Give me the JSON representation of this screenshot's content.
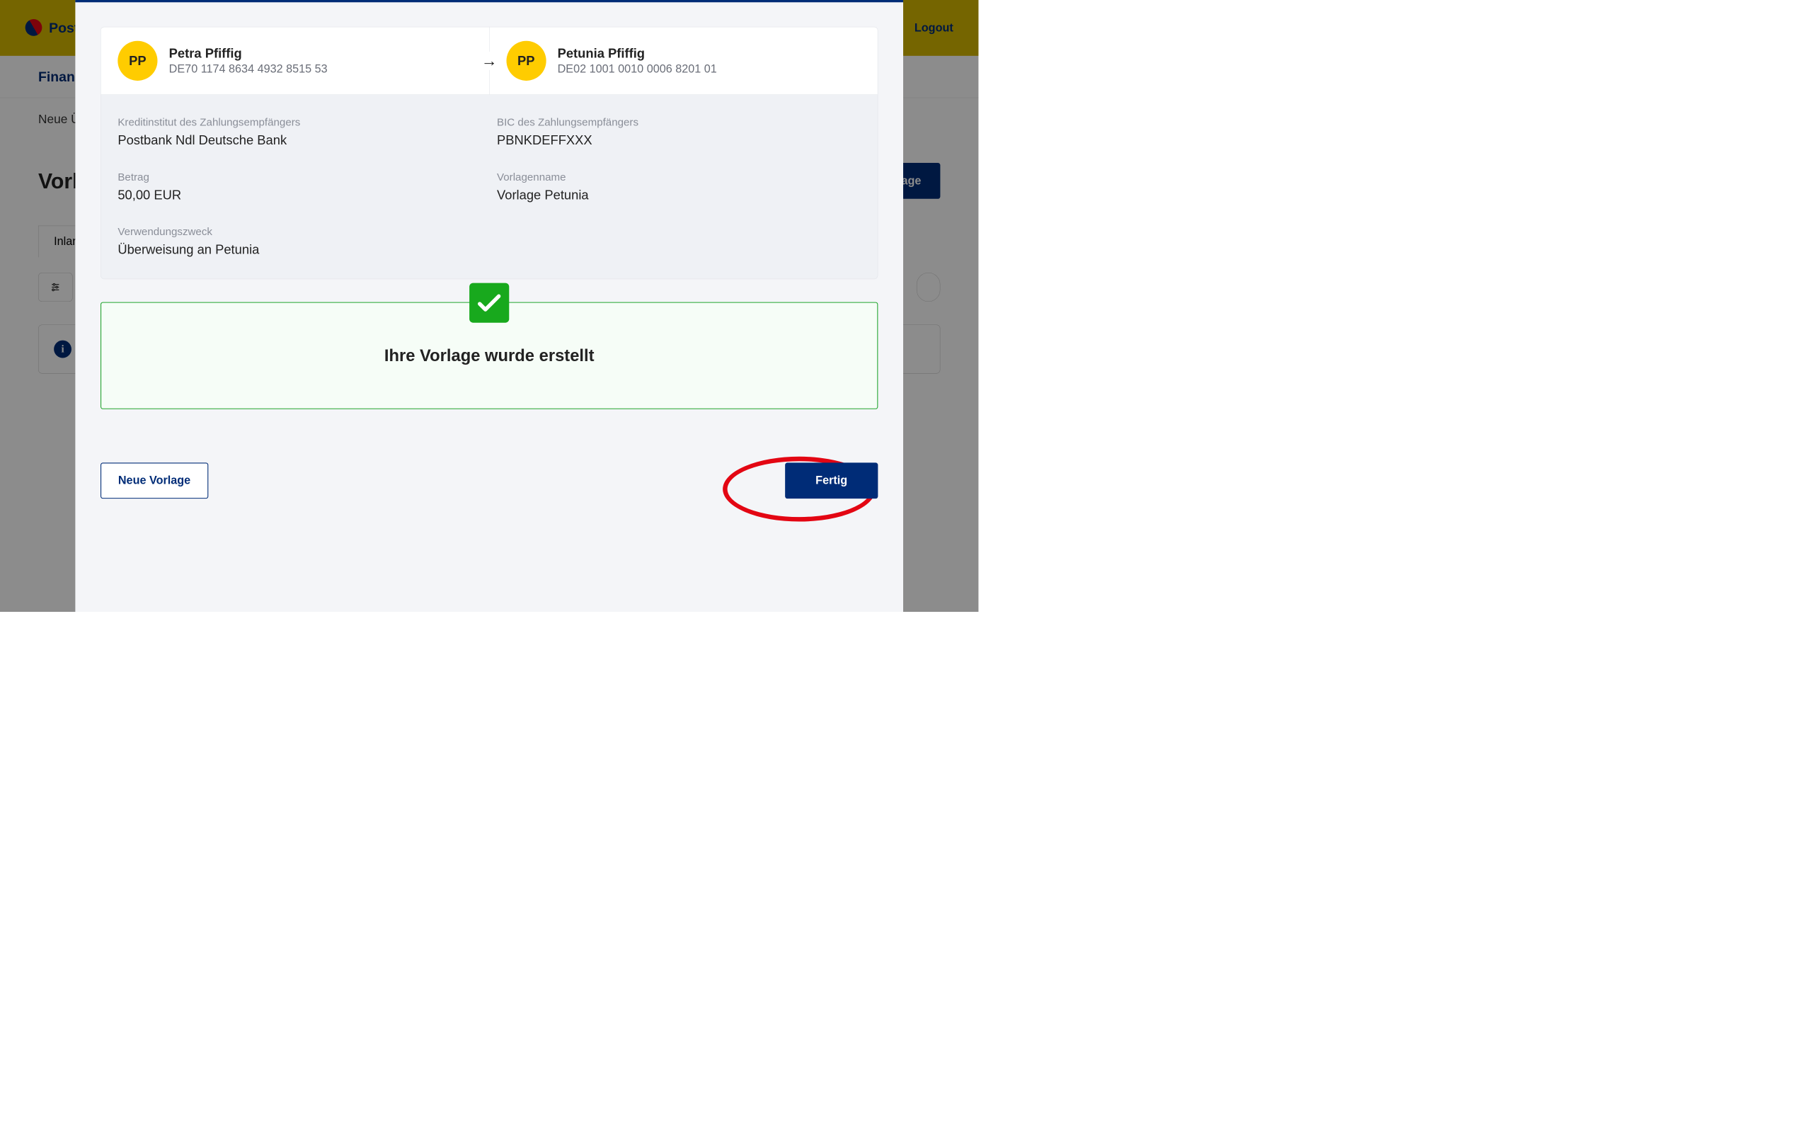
{
  "bg": {
    "brand": "Postbank",
    "logout": "Logout",
    "nav_item": "Finanzübersicht",
    "subnav": "Neue Überweisung",
    "page_title": "Vorlagen",
    "new_template_btn": "Neue Vorlage",
    "tab_label": "Inland",
    "filter_label": "Filter",
    "info_icon": "i"
  },
  "modal": {
    "sender": {
      "initials": "PP",
      "name": "Petra Pfiffig",
      "iban": "DE70 1174 8634 4932 8515 53"
    },
    "recipient": {
      "initials": "PP",
      "name": "Petunia Pfiffig",
      "iban": "DE02 1001 0010 0006 8201 01"
    },
    "details": {
      "bank_label": "Kreditinstitut des Zahlungsempfängers",
      "bank_value": "Postbank Ndl Deutsche Bank",
      "bic_label": "BIC des Zahlungsempfängers",
      "bic_value": "PBNKDEFFXXX",
      "amount_label": "Betrag",
      "amount_value": "50,00 EUR",
      "template_label": "Vorlagenname",
      "template_value": "Vorlage Petunia",
      "purpose_label": "Verwendungszweck",
      "purpose_value": "Überweisung an Petunia"
    },
    "success_message": "Ihre Vorlage wurde erstellt",
    "actions": {
      "new_template": "Neue Vorlage",
      "done": "Fertig"
    }
  }
}
